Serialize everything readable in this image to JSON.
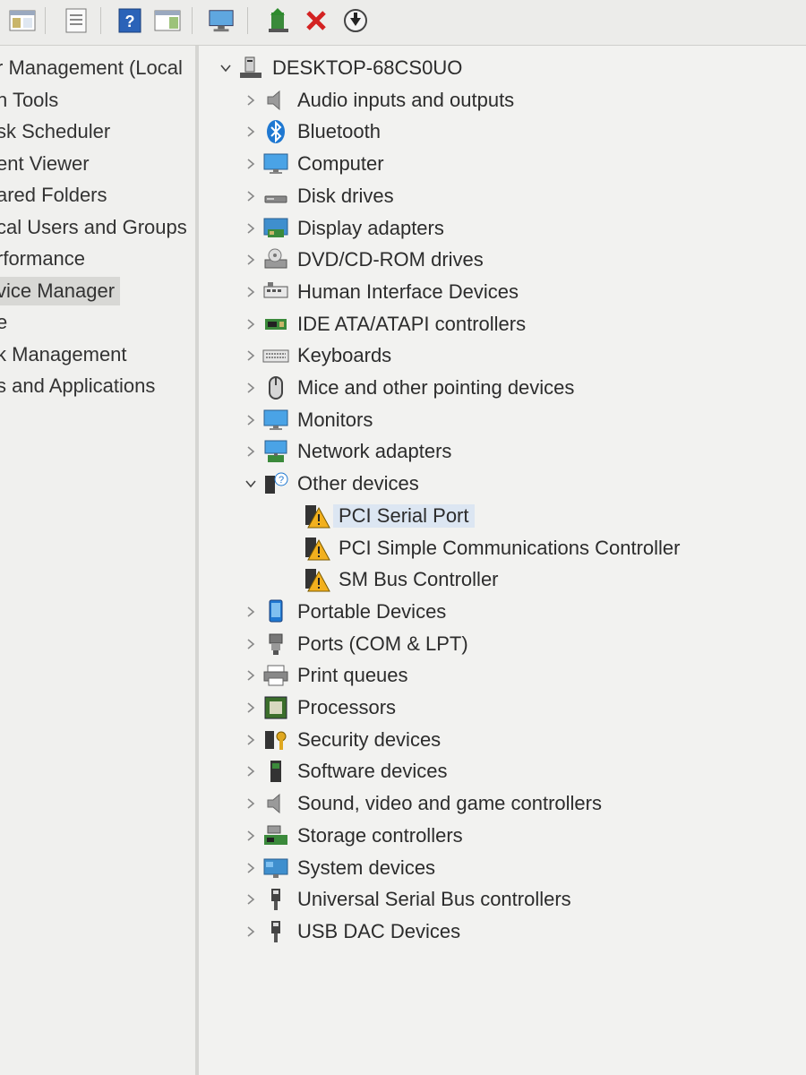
{
  "toolbar": {
    "buttons": [
      {
        "name": "console-tree-icon"
      },
      {
        "name": "properties-icon"
      },
      {
        "name": "help-icon"
      },
      {
        "name": "action-pane-icon"
      },
      {
        "name": "scan-hardware-icon"
      },
      {
        "name": "update-driver-icon"
      },
      {
        "name": "uninstall-icon"
      },
      {
        "name": "disable-device-icon"
      }
    ]
  },
  "left_nav": {
    "items": [
      {
        "label": "r Management (Local"
      },
      {
        "label": "n Tools"
      },
      {
        "label": "sk Scheduler"
      },
      {
        "label": "ent Viewer"
      },
      {
        "label": "ared Folders"
      },
      {
        "label": "cal Users and Groups"
      },
      {
        "label": "rformance"
      },
      {
        "label": "vice Manager",
        "selected": true
      },
      {
        "label": "e"
      },
      {
        "label": "k Management"
      },
      {
        "label": "s and Applications"
      }
    ]
  },
  "device_tree": {
    "root": {
      "label": "DESKTOP-68CS0UO",
      "icon": "computer-root-icon"
    },
    "categories": [
      {
        "label": "Audio inputs and outputs",
        "icon": "speaker-icon"
      },
      {
        "label": "Bluetooth",
        "icon": "bluetooth-icon"
      },
      {
        "label": "Computer",
        "icon": "monitor-icon"
      },
      {
        "label": "Disk drives",
        "icon": "disk-drive-icon"
      },
      {
        "label": "Display adapters",
        "icon": "display-adapter-icon"
      },
      {
        "label": "DVD/CD-ROM drives",
        "icon": "dvd-drive-icon"
      },
      {
        "label": "Human Interface Devices",
        "icon": "hid-icon"
      },
      {
        "label": "IDE ATA/ATAPI controllers",
        "icon": "ide-controller-icon"
      },
      {
        "label": "Keyboards",
        "icon": "keyboard-icon"
      },
      {
        "label": "Mice and other pointing devices",
        "icon": "mouse-icon"
      },
      {
        "label": "Monitors",
        "icon": "monitor-icon"
      },
      {
        "label": "Network adapters",
        "icon": "network-adapter-icon"
      },
      {
        "label": "Other devices",
        "icon": "unknown-device-icon",
        "expanded": true,
        "children": [
          {
            "label": "PCI Serial Port",
            "icon": "warning-device-icon",
            "selected": true
          },
          {
            "label": "PCI Simple Communications Controller",
            "icon": "warning-device-icon"
          },
          {
            "label": "SM Bus Controller",
            "icon": "warning-device-icon"
          }
        ]
      },
      {
        "label": "Portable Devices",
        "icon": "portable-device-icon"
      },
      {
        "label": "Ports (COM & LPT)",
        "icon": "port-icon"
      },
      {
        "label": "Print queues",
        "icon": "printer-icon"
      },
      {
        "label": "Processors",
        "icon": "processor-icon"
      },
      {
        "label": "Security devices",
        "icon": "security-device-icon"
      },
      {
        "label": "Software devices",
        "icon": "software-device-icon"
      },
      {
        "label": "Sound, video and game controllers",
        "icon": "speaker-icon"
      },
      {
        "label": "Storage controllers",
        "icon": "storage-controller-icon"
      },
      {
        "label": "System devices",
        "icon": "system-device-icon"
      },
      {
        "label": "Universal Serial Bus controllers",
        "icon": "usb-icon"
      },
      {
        "label": "USB DAC Devices",
        "icon": "usb-icon"
      }
    ]
  },
  "colors": {
    "selection": "#dce6f2",
    "accent_blue": "#1f78d1",
    "warning_yellow": "#f2b01e",
    "close_red": "#d32222"
  }
}
